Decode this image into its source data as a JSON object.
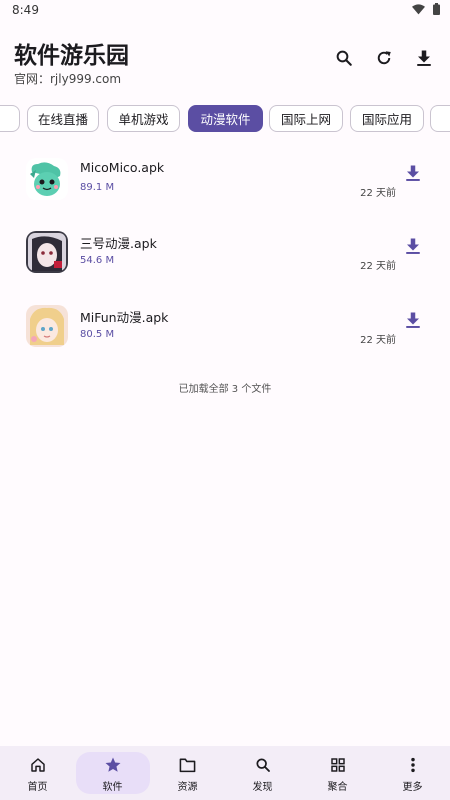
{
  "status_bar": {
    "time": "8:49"
  },
  "header": {
    "title": "软件游乐园",
    "subtitle": "官网：rjly999.com"
  },
  "chips": [
    {
      "label": ""
    },
    {
      "label": "在线直播"
    },
    {
      "label": "单机游戏"
    },
    {
      "label": "动漫软件",
      "active": true
    },
    {
      "label": "国际上网"
    },
    {
      "label": "国际应用"
    },
    {
      "label": ""
    }
  ],
  "files": [
    {
      "name": "MicoMico.apk",
      "size": "89.1 M",
      "date": "22 天前"
    },
    {
      "name": "三号动漫.apk",
      "size": "54.6 M",
      "date": "22 天前"
    },
    {
      "name": "MiFun动漫.apk",
      "size": "80.5 M",
      "date": "22 天前"
    }
  ],
  "list_footer": "已加载全部 3 个文件",
  "bottom_nav": [
    {
      "label": "首页",
      "icon": "home-icon"
    },
    {
      "label": "软件",
      "icon": "star-icon",
      "active": true
    },
    {
      "label": "资源",
      "icon": "folder-icon"
    },
    {
      "label": "发现",
      "icon": "search-icon"
    },
    {
      "label": "聚合",
      "icon": "grid-icon"
    },
    {
      "label": "更多",
      "icon": "more-vertical-icon"
    }
  ],
  "colors": {
    "accent": "#5b4ea3",
    "nav_bg": "#f3edf7",
    "nav_pill": "#e8def8"
  }
}
